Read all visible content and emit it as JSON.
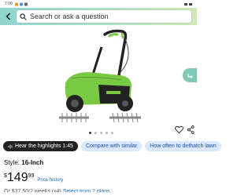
{
  "status_bar": {
    "time": "7:00"
  },
  "search": {
    "placeholder": "Search or ask a question"
  },
  "product": {
    "image_alt": "Corded electric dethatcher lawn scarifier with tine reels"
  },
  "carousel": {
    "total_dots": 5,
    "active_index": 0
  },
  "chips": [
    {
      "label": "Hear the highlights 1:45",
      "icon": "sound-wave-icon",
      "style": "dark"
    },
    {
      "label": "Compare with similar",
      "style": "light"
    },
    {
      "label": "How often to dethatch lawn",
      "style": "light"
    }
  ],
  "style_option": {
    "label": "Style:",
    "value": "16-Inch"
  },
  "price": {
    "symbol": "$",
    "whole": "149",
    "fraction": "99",
    "history_label": "Price history"
  },
  "offer_row": {
    "text": "Or $37.50/2 weeks (x4)",
    "link": "Select from 2 plans"
  },
  "colors": {
    "brand_green": "#7ac943",
    "link_blue": "#1a6fb0",
    "chip_bg": "#dbe8ff",
    "header_gradient_start": "#8fd6cf"
  }
}
